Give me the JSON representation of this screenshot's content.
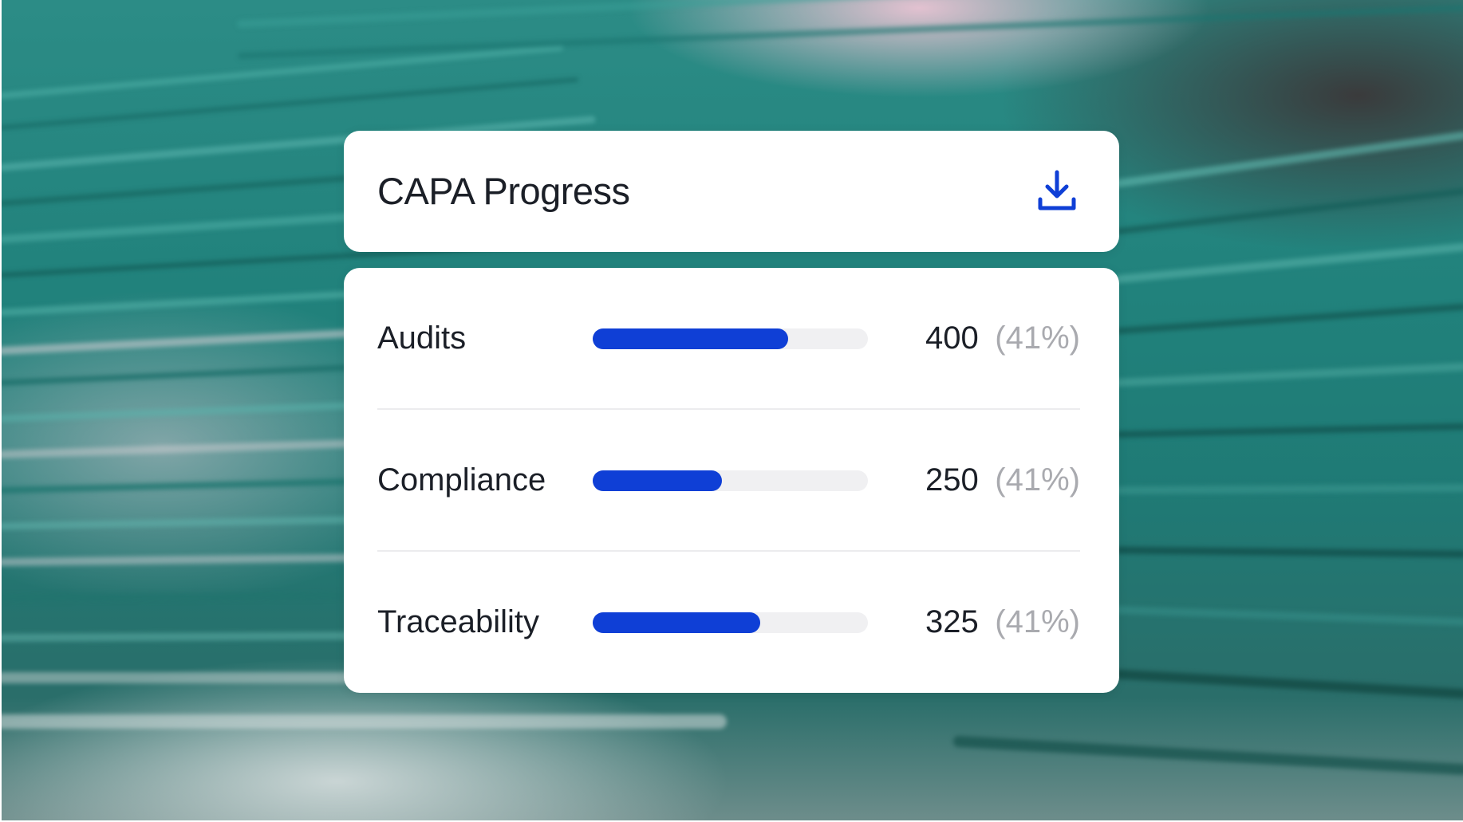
{
  "header": {
    "title": "CAPA Progress",
    "download_icon": "download-icon"
  },
  "metrics": [
    {
      "label": "Audits",
      "value": "400",
      "percent": "(41%)",
      "bar_fraction": 0.71
    },
    {
      "label": "Compliance",
      "value": "250",
      "percent": "(41%)",
      "bar_fraction": 0.47
    },
    {
      "label": "Traceability",
      "value": "325",
      "percent": "(41%)",
      "bar_fraction": 0.61
    }
  ],
  "colors": {
    "accent": "#0f3fd6",
    "track": "#f0f0f2",
    "text": "#1b1f27",
    "muted": "#a9aaaf",
    "backdrop_teal": "#21827c"
  }
}
